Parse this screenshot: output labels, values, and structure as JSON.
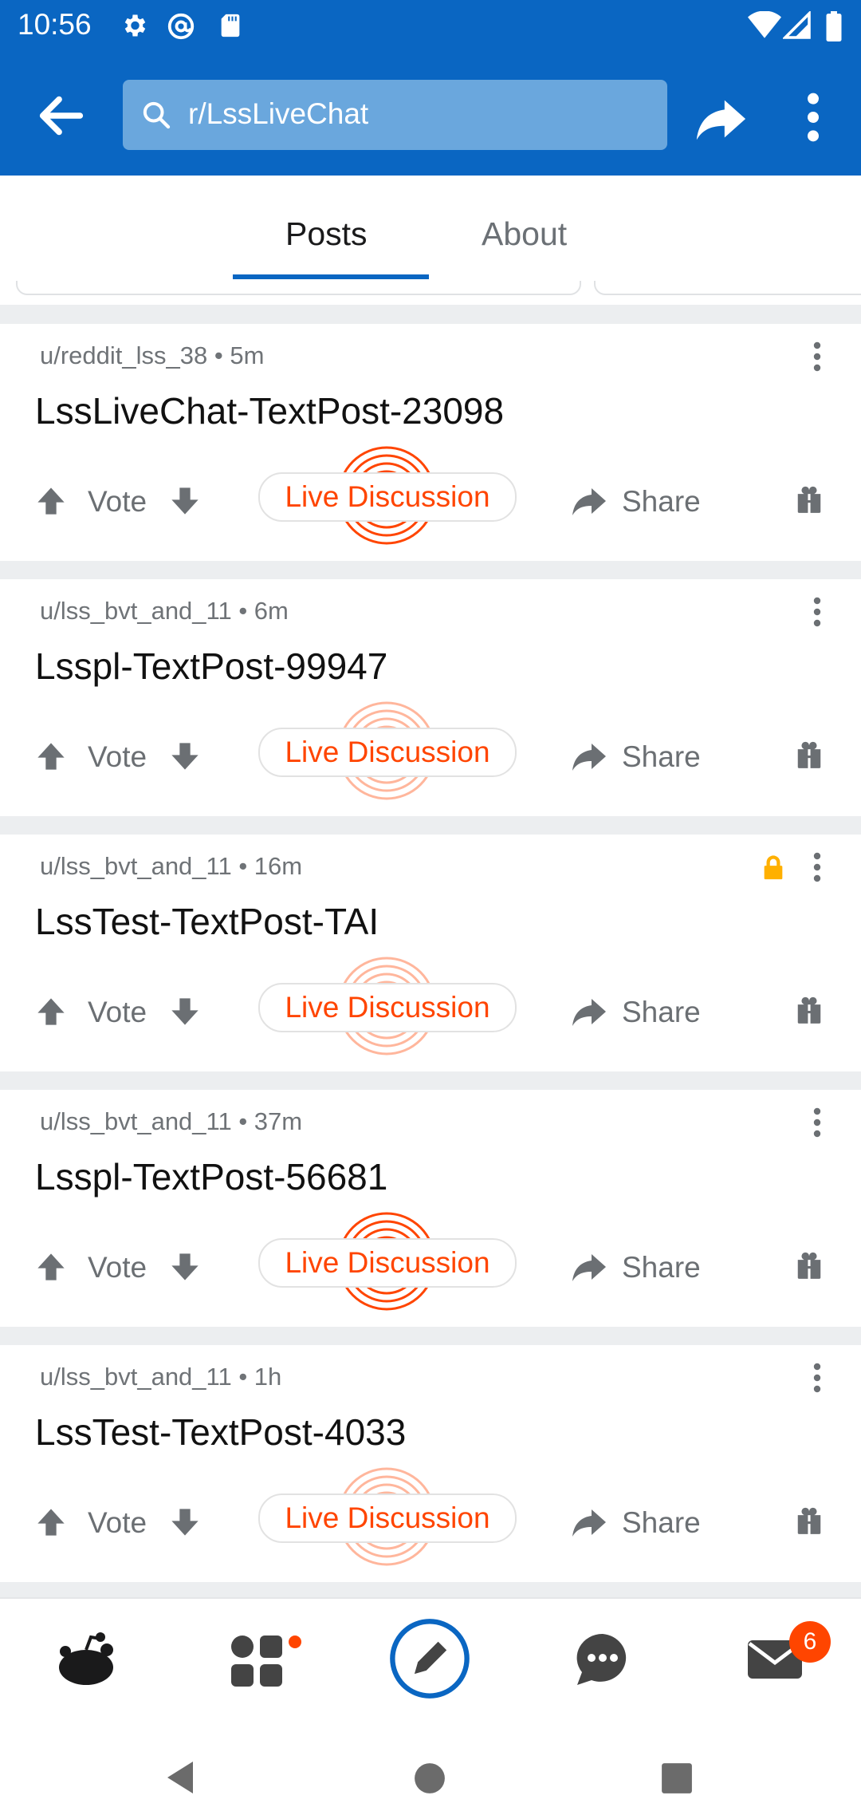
{
  "status_bar": {
    "time": "10:56",
    "icons": [
      "settings-icon",
      "at-sign-icon",
      "sd-card-icon",
      "wifi-icon",
      "signal-icon",
      "battery-icon"
    ]
  },
  "app_bar": {
    "search_text": "r/LssLiveChat",
    "icons": [
      "back-arrow-icon",
      "search-icon",
      "share-icon",
      "more-vert-icon"
    ],
    "background": "#0a66c2"
  },
  "tabs": [
    {
      "label": "Posts",
      "selected": true
    },
    {
      "label": "About",
      "selected": false
    }
  ],
  "posts": [
    {
      "meta": "u/reddit_lss_38 • 5m",
      "title": "LssLiveChat-TextPost-23098",
      "locked": false,
      "vote": "Vote",
      "live": "Live Discussion",
      "share": "Share"
    },
    {
      "meta": "u/lss_bvt_and_11 • 6m",
      "title": "Lsspl-TextPost-99947",
      "locked": false,
      "vote": "Vote",
      "live": "Live Discussion",
      "share": "Share"
    },
    {
      "meta": "u/lss_bvt_and_11 • 16m",
      "title": "LssTest-TextPost-TAI",
      "locked": true,
      "vote": "Vote",
      "live": "Live Discussion",
      "share": "Share"
    },
    {
      "meta": "u/lss_bvt_and_11 • 37m",
      "title": "Lsspl-TextPost-56681",
      "locked": false,
      "vote": "Vote",
      "live": "Live Discussion",
      "share": "Share"
    },
    {
      "meta": "u/lss_bvt_and_11 • 1h",
      "title": "LssTest-TextPost-4033",
      "locked": false,
      "vote": "Vote",
      "live": "Live Discussion",
      "share": "Share"
    }
  ],
  "bottom_nav": {
    "items": [
      "home-snoo-icon",
      "communities-icon",
      "create-post-icon",
      "chat-icon",
      "inbox-icon"
    ],
    "inbox_badge": "6"
  },
  "colors": {
    "accent": "#ff4500",
    "brand_blue": "#0a66c2",
    "lock": "#ffb000"
  }
}
